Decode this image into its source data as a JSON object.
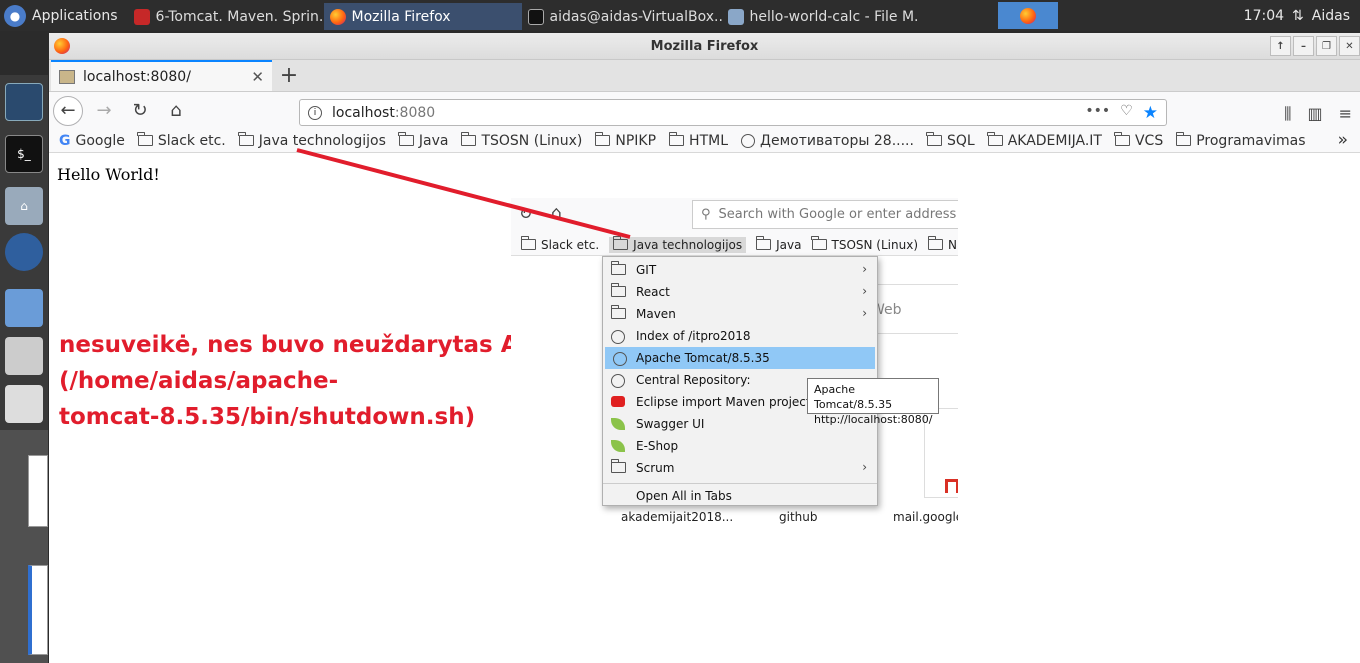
{
  "taskbar": {
    "apps_label": "Applications",
    "tasks": [
      {
        "label": "6-Tomcat. Maven. Sprin...",
        "active": false
      },
      {
        "label": "Mozilla Firefox",
        "active": true
      },
      {
        "label": "aidas@aidas-VirtualBox...",
        "active": false
      },
      {
        "label": "hello-world-calc - File M...",
        "active": false
      }
    ],
    "clock": "17:04",
    "user": "Aidas"
  },
  "window": {
    "title": "Mozilla Firefox"
  },
  "tab": {
    "label": "localhost:8080/"
  },
  "urlbar": {
    "host": "localhost",
    "port": ":8080",
    "dots": "•••"
  },
  "bookmarks": [
    {
      "label": "Google",
      "icon": "google-icon"
    },
    {
      "label": "Slack etc.",
      "icon": "folder-icon"
    },
    {
      "label": "Java technologijos",
      "icon": "folder-icon"
    },
    {
      "label": "Java",
      "icon": "folder-icon"
    },
    {
      "label": "TSOSN (Linux)",
      "icon": "folder-icon"
    },
    {
      "label": "NPIKP",
      "icon": "folder-icon"
    },
    {
      "label": "HTML",
      "icon": "folder-icon"
    },
    {
      "label": "Демотиваторы 28.....",
      "icon": "globe-icon"
    },
    {
      "label": "SQL",
      "icon": "folder-icon"
    },
    {
      "label": "AKADEMIJA.IT",
      "icon": "folder-icon"
    },
    {
      "label": "VCS",
      "icon": "folder-icon"
    },
    {
      "label": "Programavimas",
      "icon": "folder-icon"
    }
  ],
  "page": {
    "hello": "Hello World!",
    "annotation_line1": "nesuveikė, nes buvo neuždarytas Apache",
    "annotation_line2": "(/home/aidas/apache-",
    "annotation_line3": "tomcat-8.5.35/bin/shutdown.sh)",
    "annotation_color": "#e11d2c"
  },
  "inset": {
    "search_placeholder": "Search with Google or enter address",
    "bookmarks": [
      "Slack etc.",
      "Java technologijos",
      "Java",
      "TSOSN (Linux)",
      "NPIKP"
    ],
    "menu": [
      {
        "label": "GIT",
        "icon": "folder",
        "submenu": true
      },
      {
        "label": "React",
        "icon": "folder",
        "submenu": true
      },
      {
        "label": "Maven",
        "icon": "folder",
        "submenu": true
      },
      {
        "label": "Index of /itpro2018",
        "icon": "globe",
        "submenu": false
      },
      {
        "label": "Apache Tomcat/8.5.35",
        "icon": "globe",
        "submenu": false,
        "highlighted": true
      },
      {
        "label": "Central Repository:",
        "icon": "globe",
        "submenu": false
      },
      {
        "label": "Eclipse import Maven project - Y",
        "icon": "youtube",
        "submenu": false
      },
      {
        "label": "Swagger UI",
        "icon": "leaf",
        "submenu": false
      },
      {
        "label": "E-Shop",
        "icon": "leaf",
        "submenu": false
      },
      {
        "label": "Scrum",
        "icon": "folder",
        "submenu": true
      }
    ],
    "open_all": "Open All in Tabs",
    "tooltip_line1": "Apache Tomcat/8.5.35",
    "tooltip_line2": "http://localhost:8080/",
    "web_hint": "Web",
    "tiles": [
      "akademijait2018...",
      "github",
      "mail.google"
    ]
  }
}
